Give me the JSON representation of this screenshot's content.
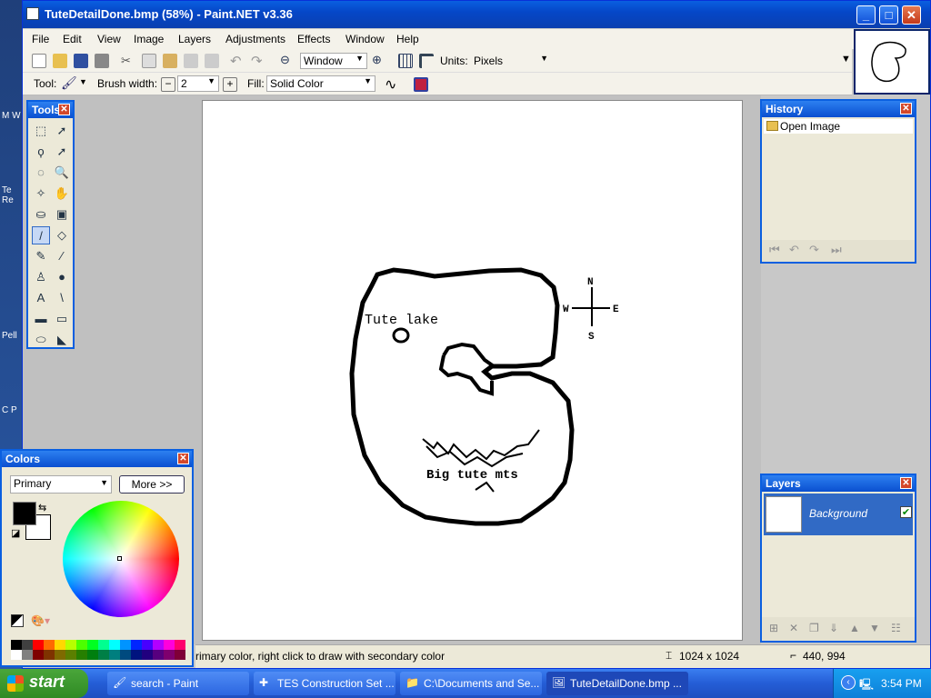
{
  "desktop": {
    "labels": [
      "M\nW",
      "Te\nRe",
      "Pell",
      "C\nP"
    ]
  },
  "window": {
    "title": "TuteDetailDone.bmp (58%) - Paint.NET v3.36",
    "min": "_",
    "max": "□",
    "close": "✕"
  },
  "menu": [
    "File",
    "Edit",
    "View",
    "Image",
    "Layers",
    "Adjustments",
    "Effects",
    "Window",
    "Help"
  ],
  "toolbar1": {
    "zoom_value": "Window",
    "units_label": "Units:",
    "units_value": "Pixels"
  },
  "toolbar2": {
    "tool_label": "Tool:",
    "brush_label": "Brush width:",
    "brush_value": "2",
    "fill_label": "Fill:",
    "fill_value": "Solid Color"
  },
  "tools_panel": {
    "title": "Tools",
    "close": "✕",
    "icons": [
      "rect-select-icon",
      "move-selection-icon",
      "lasso-select-icon",
      "move-selected-icon",
      "ellipse-select-icon",
      "zoom-icon",
      "magic-wand-icon",
      "pan-icon",
      "paint-bucket-icon",
      "gradient-icon",
      "paintbrush-icon",
      "eraser-icon",
      "pencil-icon",
      "color-picker-icon",
      "clone-stamp-icon",
      "recolor-icon",
      "text-icon",
      "line-icon",
      "rectangle-icon",
      "rounded-rectangle-icon",
      "ellipse-icon",
      "freeform-shape-icon"
    ],
    "glyphs": [
      "⬚",
      "➚",
      "ϙ",
      "➚",
      "◌",
      "🔍",
      "✧",
      "✋",
      "⛀",
      "▣",
      "/",
      "◇",
      "✎",
      "⁄",
      "♙",
      "●",
      "A",
      "\\",
      "▬",
      "▭",
      "⬭",
      "◣"
    ]
  },
  "canvas": {
    "lake_label": "Tute lake",
    "mts_label": "Big tute mts",
    "compass": {
      "n": "N",
      "s": "S",
      "e": "E",
      "w": "W"
    }
  },
  "history": {
    "title": "History",
    "close": "✕",
    "items": [
      "Open Image"
    ]
  },
  "layers": {
    "title": "Layers",
    "close": "✕",
    "items": [
      {
        "name": "Background",
        "visible": true
      }
    ]
  },
  "colors": {
    "title": "Colors",
    "close": "✕",
    "mode": "Primary",
    "more_button": "More >>",
    "primary": "#000000",
    "secondary": "#ffffff",
    "palette": [
      "#000000",
      "#404040",
      "#ff0000",
      "#ff6a00",
      "#ffd800",
      "#b6ff00",
      "#4cff00",
      "#00ff21",
      "#00ff90",
      "#00ffff",
      "#0094ff",
      "#0026ff",
      "#4800ff",
      "#b200ff",
      "#ff00dc",
      "#ff006e",
      "#ffffff",
      "#808080",
      "#7f0000",
      "#7f3300",
      "#7f6a00",
      "#5b7f00",
      "#267f00",
      "#007f0e",
      "#007f46",
      "#007f7f",
      "#004a7f",
      "#00137f",
      "#21007f",
      "#57007f",
      "#7f006e",
      "#7f0037"
    ]
  },
  "status": {
    "hint": "rimary color, right click to draw with secondary color",
    "size": "1024 x 1024",
    "cursor": "440, 994"
  },
  "taskbar": {
    "start": "start",
    "tasks": [
      "search - Paint",
      "TES Construction Set ...",
      "C:\\Documents and Se...",
      "TuteDetailDone.bmp ..."
    ],
    "clock": "3:54 PM"
  }
}
